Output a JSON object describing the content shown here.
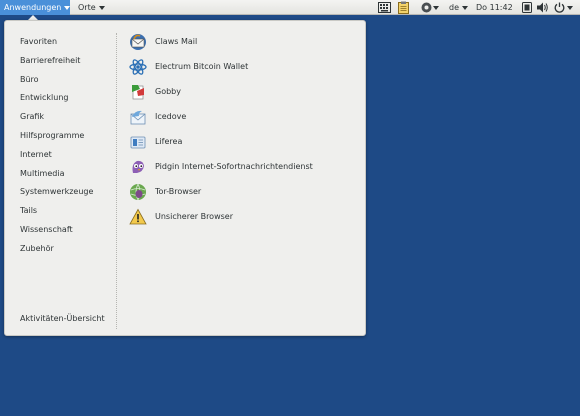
{
  "topbar": {
    "applications_label": "Anwendungen",
    "places_label": "Orte",
    "keyboard_layout": "de",
    "clock": "Do 11:42"
  },
  "menu": {
    "categories": [
      "Favoriten",
      "Barrierefreiheit",
      "Büro",
      "Entwicklung",
      "Grafik",
      "Hilfsprogramme",
      "Internet",
      "Multimedia",
      "Systemwerkzeuge",
      "Tails",
      "Wissenschaft",
      "Zubehör"
    ],
    "overview_label": "Aktivitäten-Übersicht",
    "apps": [
      {
        "label": "Claws Mail",
        "icon": "claws-mail-icon"
      },
      {
        "label": "Electrum Bitcoin Wallet",
        "icon": "electrum-icon"
      },
      {
        "label": "Gobby",
        "icon": "gobby-icon"
      },
      {
        "label": "Icedove",
        "icon": "icedove-icon"
      },
      {
        "label": "Liferea",
        "icon": "liferea-icon"
      },
      {
        "label": "Pidgin Internet-Sofortnachrichtendienst",
        "icon": "pidgin-icon"
      },
      {
        "label": "Tor-Browser",
        "icon": "tor-browser-icon"
      },
      {
        "label": "Unsicherer Browser",
        "icon": "warning-icon"
      }
    ]
  },
  "colors": {
    "desktop": "#1e4a86",
    "accent": "#4a90d9",
    "menu_bg": "#efefed"
  }
}
